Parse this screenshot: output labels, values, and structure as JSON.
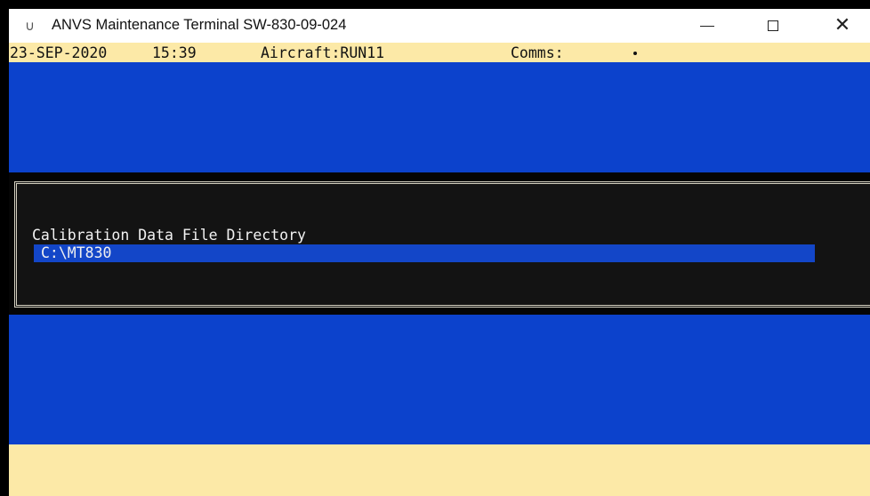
{
  "window": {
    "icon": "app-icon",
    "icon_glyph": "∪",
    "title": "ANVS Maintenance Terminal SW-830-09-024",
    "controls": {
      "minimize": "minimize-icon",
      "maximize": "maximize-icon",
      "close_glyph": "✕"
    }
  },
  "status_bar": {
    "date": "23-SEP-2020",
    "time": "15:39",
    "aircraft": "Aircraft:RUN11",
    "comms_label": "Comms:"
  },
  "dialog": {
    "label": "Calibration Data File Directory",
    "input_value": "C:\\MT830"
  },
  "colors": {
    "status_bar_bg": "#fce9a7",
    "terminal_blue": "#0c42cc",
    "dialog_bg": "#131313",
    "input_highlight": "#1346c8"
  }
}
